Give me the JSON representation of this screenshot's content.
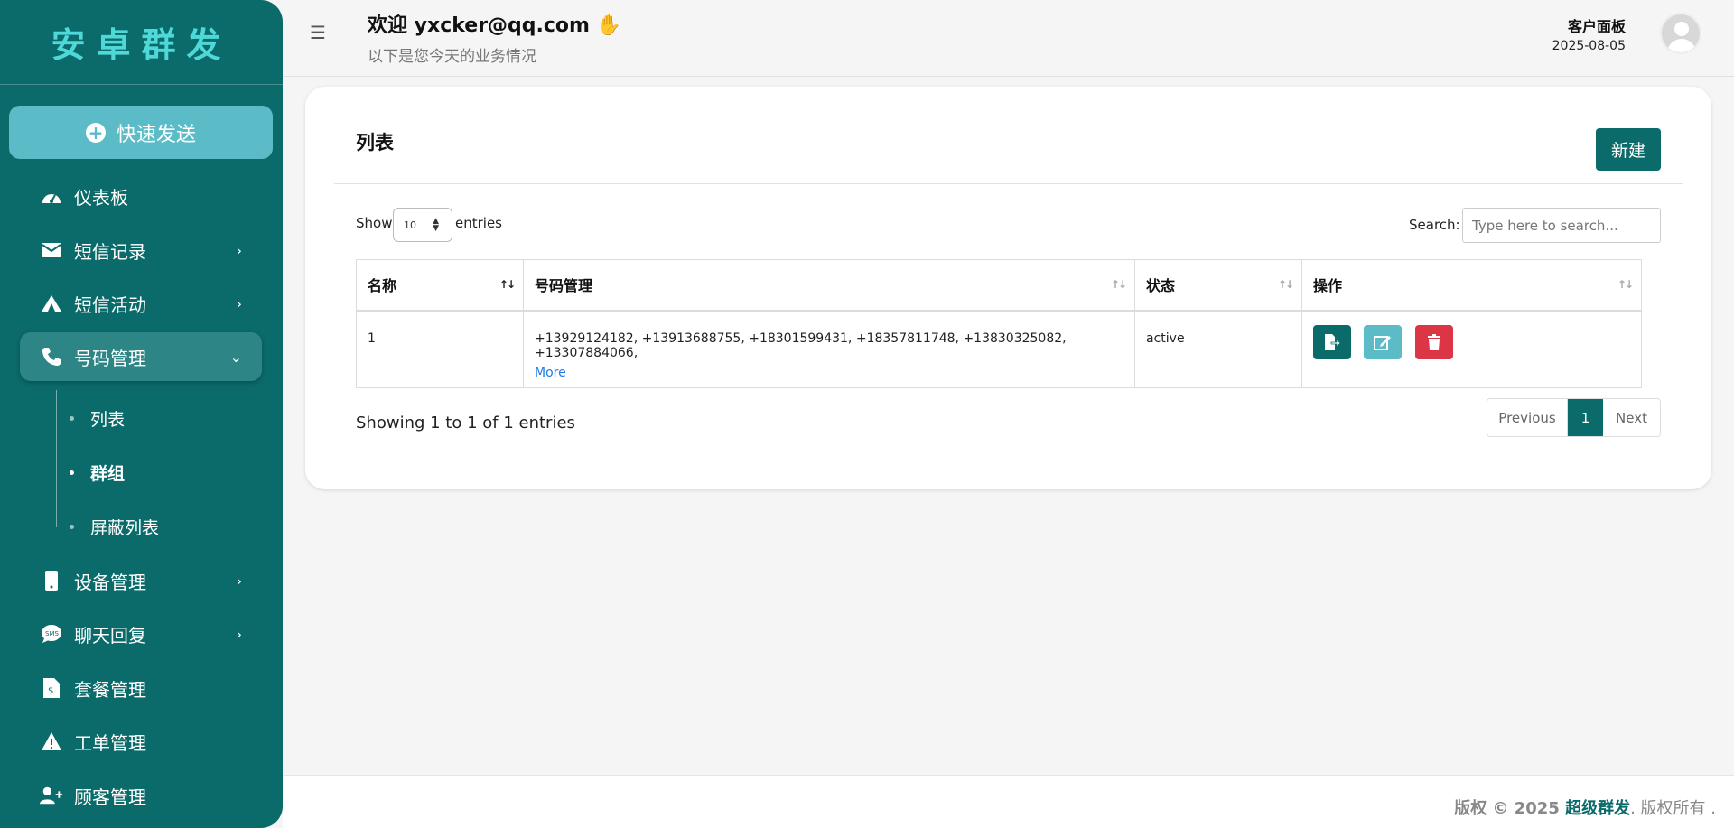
{
  "sidebar": {
    "brand": "安卓群发",
    "quick_send": "快速发送",
    "items": [
      {
        "label": "仪表板",
        "icon": "dashboard-icon"
      },
      {
        "label": "短信记录",
        "icon": "envelope-icon"
      },
      {
        "label": "短信活动",
        "icon": "campground-icon"
      },
      {
        "label": "号码管理",
        "icon": "phone-icon"
      },
      {
        "label": "设备管理",
        "icon": "mobile-icon"
      },
      {
        "label": "聊天回复",
        "icon": "sms-bubble-icon"
      },
      {
        "label": "套餐管理",
        "icon": "invoice-icon"
      },
      {
        "label": "工单管理",
        "icon": "warning-icon"
      },
      {
        "label": "顾客管理",
        "icon": "user-plus-icon"
      }
    ],
    "sub_items": [
      {
        "label": "列表"
      },
      {
        "label": "群组"
      },
      {
        "label": "屏蔽列表"
      }
    ]
  },
  "header": {
    "welcome": "欢迎 yxcker@qq.com",
    "subtitle": "以下是您今天的业务情况",
    "panel_title": "客户面板",
    "date": "2025-08-05"
  },
  "card": {
    "title": "列表",
    "new_button": "新建",
    "show_label": "Show",
    "page_size": "10",
    "entries_label": "entries",
    "search_label": "Search:",
    "search_placeholder": "Type here to search...",
    "columns": [
      "名称",
      "号码管理",
      "状态",
      "操作"
    ],
    "rows": [
      {
        "name": "1",
        "numbers": "+13929124182, +13913688755, +18301599431, +18357811748, +13830325082, +13307884066,",
        "more": "More",
        "status": "active"
      }
    ],
    "showing": "Showing 1 to 1 of 1 entries",
    "pagination": {
      "prev": "Previous",
      "current": "1",
      "next": "Next"
    }
  },
  "footer": {
    "prefix": "版权 © 2025 ",
    "brand": "超级群发",
    "suffix": ". 版权所有 ."
  },
  "colors": {
    "primary": "#0b6b6b",
    "accent": "#5bbcc7",
    "danger": "#dc3545",
    "link": "#1e7be6"
  }
}
